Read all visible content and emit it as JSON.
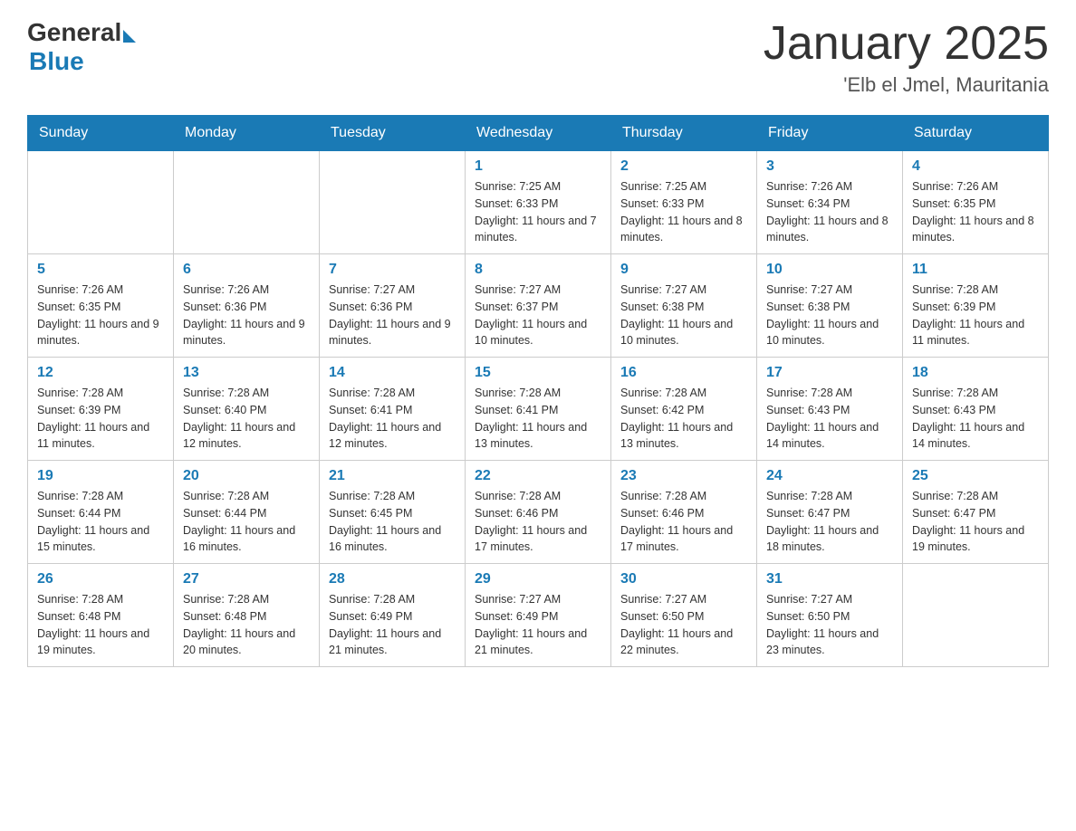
{
  "logo": {
    "general": "General",
    "blue": "Blue"
  },
  "title": "January 2025",
  "location": "'Elb el Jmel, Mauritania",
  "days_of_week": [
    "Sunday",
    "Monday",
    "Tuesday",
    "Wednesday",
    "Thursday",
    "Friday",
    "Saturday"
  ],
  "weeks": [
    [
      {
        "day": "",
        "info": ""
      },
      {
        "day": "",
        "info": ""
      },
      {
        "day": "",
        "info": ""
      },
      {
        "day": "1",
        "info": "Sunrise: 7:25 AM\nSunset: 6:33 PM\nDaylight: 11 hours and 7 minutes."
      },
      {
        "day": "2",
        "info": "Sunrise: 7:25 AM\nSunset: 6:33 PM\nDaylight: 11 hours and 8 minutes."
      },
      {
        "day": "3",
        "info": "Sunrise: 7:26 AM\nSunset: 6:34 PM\nDaylight: 11 hours and 8 minutes."
      },
      {
        "day": "4",
        "info": "Sunrise: 7:26 AM\nSunset: 6:35 PM\nDaylight: 11 hours and 8 minutes."
      }
    ],
    [
      {
        "day": "5",
        "info": "Sunrise: 7:26 AM\nSunset: 6:35 PM\nDaylight: 11 hours and 9 minutes."
      },
      {
        "day": "6",
        "info": "Sunrise: 7:26 AM\nSunset: 6:36 PM\nDaylight: 11 hours and 9 minutes."
      },
      {
        "day": "7",
        "info": "Sunrise: 7:27 AM\nSunset: 6:36 PM\nDaylight: 11 hours and 9 minutes."
      },
      {
        "day": "8",
        "info": "Sunrise: 7:27 AM\nSunset: 6:37 PM\nDaylight: 11 hours and 10 minutes."
      },
      {
        "day": "9",
        "info": "Sunrise: 7:27 AM\nSunset: 6:38 PM\nDaylight: 11 hours and 10 minutes."
      },
      {
        "day": "10",
        "info": "Sunrise: 7:27 AM\nSunset: 6:38 PM\nDaylight: 11 hours and 10 minutes."
      },
      {
        "day": "11",
        "info": "Sunrise: 7:28 AM\nSunset: 6:39 PM\nDaylight: 11 hours and 11 minutes."
      }
    ],
    [
      {
        "day": "12",
        "info": "Sunrise: 7:28 AM\nSunset: 6:39 PM\nDaylight: 11 hours and 11 minutes."
      },
      {
        "day": "13",
        "info": "Sunrise: 7:28 AM\nSunset: 6:40 PM\nDaylight: 11 hours and 12 minutes."
      },
      {
        "day": "14",
        "info": "Sunrise: 7:28 AM\nSunset: 6:41 PM\nDaylight: 11 hours and 12 minutes."
      },
      {
        "day": "15",
        "info": "Sunrise: 7:28 AM\nSunset: 6:41 PM\nDaylight: 11 hours and 13 minutes."
      },
      {
        "day": "16",
        "info": "Sunrise: 7:28 AM\nSunset: 6:42 PM\nDaylight: 11 hours and 13 minutes."
      },
      {
        "day": "17",
        "info": "Sunrise: 7:28 AM\nSunset: 6:43 PM\nDaylight: 11 hours and 14 minutes."
      },
      {
        "day": "18",
        "info": "Sunrise: 7:28 AM\nSunset: 6:43 PM\nDaylight: 11 hours and 14 minutes."
      }
    ],
    [
      {
        "day": "19",
        "info": "Sunrise: 7:28 AM\nSunset: 6:44 PM\nDaylight: 11 hours and 15 minutes."
      },
      {
        "day": "20",
        "info": "Sunrise: 7:28 AM\nSunset: 6:44 PM\nDaylight: 11 hours and 16 minutes."
      },
      {
        "day": "21",
        "info": "Sunrise: 7:28 AM\nSunset: 6:45 PM\nDaylight: 11 hours and 16 minutes."
      },
      {
        "day": "22",
        "info": "Sunrise: 7:28 AM\nSunset: 6:46 PM\nDaylight: 11 hours and 17 minutes."
      },
      {
        "day": "23",
        "info": "Sunrise: 7:28 AM\nSunset: 6:46 PM\nDaylight: 11 hours and 17 minutes."
      },
      {
        "day": "24",
        "info": "Sunrise: 7:28 AM\nSunset: 6:47 PM\nDaylight: 11 hours and 18 minutes."
      },
      {
        "day": "25",
        "info": "Sunrise: 7:28 AM\nSunset: 6:47 PM\nDaylight: 11 hours and 19 minutes."
      }
    ],
    [
      {
        "day": "26",
        "info": "Sunrise: 7:28 AM\nSunset: 6:48 PM\nDaylight: 11 hours and 19 minutes."
      },
      {
        "day": "27",
        "info": "Sunrise: 7:28 AM\nSunset: 6:48 PM\nDaylight: 11 hours and 20 minutes."
      },
      {
        "day": "28",
        "info": "Sunrise: 7:28 AM\nSunset: 6:49 PM\nDaylight: 11 hours and 21 minutes."
      },
      {
        "day": "29",
        "info": "Sunrise: 7:27 AM\nSunset: 6:49 PM\nDaylight: 11 hours and 21 minutes."
      },
      {
        "day": "30",
        "info": "Sunrise: 7:27 AM\nSunset: 6:50 PM\nDaylight: 11 hours and 22 minutes."
      },
      {
        "day": "31",
        "info": "Sunrise: 7:27 AM\nSunset: 6:50 PM\nDaylight: 11 hours and 23 minutes."
      },
      {
        "day": "",
        "info": ""
      }
    ]
  ]
}
